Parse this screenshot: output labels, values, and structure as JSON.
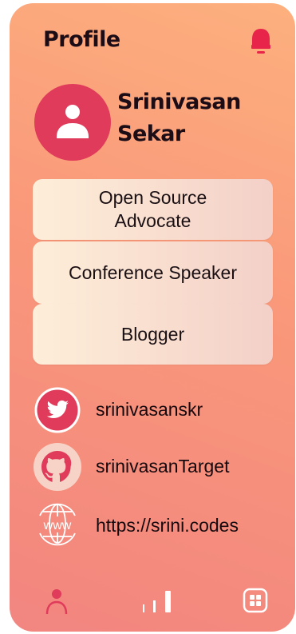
{
  "header": {
    "title": "Profile",
    "bell_icon": "bell-icon",
    "accent": "#e03b5a"
  },
  "profile": {
    "first_name": "Srinivasan",
    "last_name": "Sekar",
    "avatar_icon": "user-icon"
  },
  "tags": [
    {
      "line1": "Open Source",
      "line2": "Advocate"
    },
    {
      "line1": "Conference Speaker"
    },
    {
      "line1": "Blogger"
    }
  ],
  "socials": [
    {
      "icon": "twitter-icon",
      "text": "srinivasanskr"
    },
    {
      "icon": "github-icon",
      "text": "srinivasanTarget"
    },
    {
      "icon": "globe-www-icon",
      "text": "https://srini.codes"
    }
  ],
  "bottom_nav": [
    {
      "icon": "profile-icon",
      "active": true
    },
    {
      "icon": "stats-icon",
      "active": false
    },
    {
      "icon": "apps-grid-icon",
      "active": false
    }
  ]
}
